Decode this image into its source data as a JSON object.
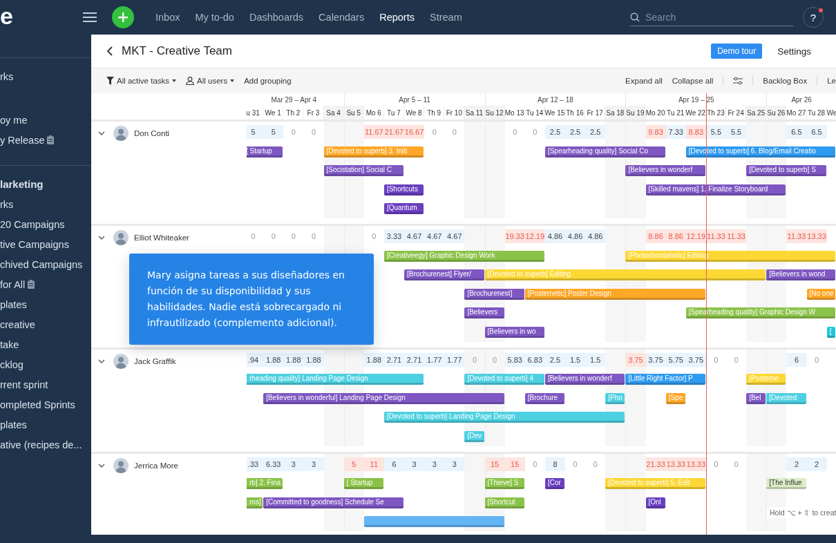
{
  "topbar": {
    "logo": "e",
    "nav": [
      {
        "label": "Inbox",
        "selected": false
      },
      {
        "label": "My to-do",
        "selected": false
      },
      {
        "label": "Dashboards",
        "selected": false
      },
      {
        "label": "Calendars",
        "selected": false
      },
      {
        "label": "Reports",
        "selected": true
      },
      {
        "label": "Stream",
        "selected": false
      }
    ],
    "search": {
      "placeholder": "Search"
    },
    "help": "?",
    "help_badge": true
  },
  "sidebar": {
    "groups": [
      {
        "divider": true,
        "items": [
          {
            "label": "rks",
            "kind": "link"
          }
        ]
      },
      {
        "divider": false,
        "items": [
          {
            "label": "oy me",
            "kind": "link"
          },
          {
            "label": "y Release",
            "kind": "doc"
          }
        ]
      },
      {
        "divider": true,
        "items": [
          {
            "label": "larketing",
            "kind": "heading"
          },
          {
            "label": "rks",
            "kind": "link"
          },
          {
            "label": "20 Campaigns",
            "kind": "link"
          },
          {
            "label": "tive Campaigns",
            "kind": "link"
          },
          {
            "label": "chived Campaigns",
            "kind": "link"
          },
          {
            "label": "for All",
            "kind": "doc"
          },
          {
            "label": "plates",
            "kind": "link"
          },
          {
            "label": "creative",
            "kind": "link"
          },
          {
            "label": "take",
            "kind": "link"
          },
          {
            "label": "cklog",
            "kind": "link"
          },
          {
            "label": "rrent sprint",
            "kind": "link"
          },
          {
            "label": "ompleted Sprints",
            "kind": "link"
          },
          {
            "label": "plates",
            "kind": "link"
          },
          {
            "label": "ative (recipes de...",
            "kind": "link"
          }
        ]
      }
    ]
  },
  "header": {
    "title": "MKT - Creative Team",
    "demo_button": "Demo tour",
    "settings": "Settings"
  },
  "toolbar": {
    "task_filter": "All active tasks",
    "user_filter": "All users",
    "grouping": "Add grouping",
    "expand": "Expand all",
    "collapse": "Collapse all",
    "backlog": "Backlog Box",
    "more": "Le"
  },
  "timeline": {
    "weeks": [
      {
        "label": "Mar 29 – Apr 4",
        "days": [
          {
            "label": "u 31",
            "weekend": false,
            "today": false
          },
          {
            "label": "We 1",
            "weekend": false,
            "today": false
          },
          {
            "label": "Th 2",
            "weekend": false,
            "today": false
          },
          {
            "label": "Fr 3",
            "weekend": false,
            "today": false
          },
          {
            "label": "Sa 4",
            "weekend": true,
            "today": false
          }
        ]
      },
      {
        "label": "Apr 5 – 11",
        "days": [
          {
            "label": "Su 5",
            "weekend": true,
            "today": false
          },
          {
            "label": "Mo 6",
            "weekend": false,
            "today": false
          },
          {
            "label": "Tu 7",
            "weekend": false,
            "today": false
          },
          {
            "label": "We 8",
            "weekend": false,
            "today": false
          },
          {
            "label": "Th 9",
            "weekend": false,
            "today": false
          },
          {
            "label": "Fr 10",
            "weekend": false,
            "today": false
          },
          {
            "label": "Sa 11",
            "weekend": true,
            "today": false
          }
        ]
      },
      {
        "label": "Apr 12 – 18",
        "days": [
          {
            "label": "Su 12",
            "weekend": true,
            "today": false
          },
          {
            "label": "Mo 13",
            "weekend": false,
            "today": false
          },
          {
            "label": "Tu 14",
            "weekend": false,
            "today": false
          },
          {
            "label": "We 15",
            "weekend": false,
            "today": false
          },
          {
            "label": "Th 16",
            "weekend": false,
            "today": false
          },
          {
            "label": "Fr 17",
            "weekend": false,
            "today": false
          },
          {
            "label": "Sa 18",
            "weekend": true,
            "today": false
          }
        ]
      },
      {
        "label": "Apr 19 – 25",
        "days": [
          {
            "label": "Su 19",
            "weekend": true,
            "today": false
          },
          {
            "label": "Mo 20",
            "weekend": false,
            "today": false
          },
          {
            "label": "Tu 21",
            "weekend": false,
            "today": false
          },
          {
            "label": "We 22",
            "weekend": false,
            "today": false
          },
          {
            "label": "Th 23",
            "weekend": false,
            "today": true
          },
          {
            "label": "Fr 24",
            "weekend": false,
            "today": false
          },
          {
            "label": "Sa 25",
            "weekend": true,
            "today": false
          }
        ]
      },
      {
        "label": "Apr 26",
        "days": [
          {
            "label": "Su 26",
            "weekend": true,
            "today": false
          },
          {
            "label": "Mo 27",
            "weekend": false,
            "today": false
          },
          {
            "label": "Tu 28",
            "weekend": false,
            "today": false
          },
          {
            "label": "We",
            "weekend": false,
            "today": false
          }
        ]
      }
    ]
  },
  "people": [
    {
      "name": "Don Conti",
      "expanded": true,
      "cells": [
        {
          "value": "5",
          "kind": "normal"
        },
        {
          "value": "5",
          "kind": "normal"
        },
        {
          "value": "0",
          "kind": "zero"
        },
        {
          "value": "0",
          "kind": "zero"
        },
        {
          "kind": "empty"
        },
        {
          "kind": "empty"
        },
        {
          "value": "11.67",
          "kind": "over"
        },
        {
          "value": "21.67",
          "kind": "over"
        },
        {
          "value": "16.67",
          "kind": "over"
        },
        {
          "value": "0",
          "kind": "zero"
        },
        {
          "value": "0",
          "kind": "zero"
        },
        {
          "kind": "empty"
        },
        {
          "kind": "empty"
        },
        {
          "value": "0",
          "kind": "zero"
        },
        {
          "value": "0",
          "kind": "zero"
        },
        {
          "value": "2.5",
          "kind": "normal"
        },
        {
          "value": "2.5",
          "kind": "normal"
        },
        {
          "value": "2.5",
          "kind": "normal"
        },
        {
          "kind": "empty"
        },
        {
          "kind": "empty"
        },
        {
          "value": "9.83",
          "kind": "over"
        },
        {
          "value": "7.33",
          "kind": "normal"
        },
        {
          "value": "8.83",
          "kind": "over"
        },
        {
          "value": "5.5",
          "kind": "normal"
        },
        {
          "value": "5.5",
          "kind": "normal"
        },
        {
          "kind": "empty"
        },
        {
          "kind": "empty"
        },
        {
          "value": "6.5",
          "kind": "normal"
        },
        {
          "value": "6.5",
          "kind": "normal"
        },
        {
          "kind": "empty"
        }
      ],
      "lanes": [
        [
          {
            "label": "[ Startup",
            "color": "#7e57c2"
          },
          {
            "label": "[Devoted to superb] 3. Initi",
            "color": "#ffa726"
          },
          {
            "label": "[Spearheading quality] Social Co",
            "color": "#7e57c2"
          },
          {
            "label": "[Devoted to superb] 6. Blog/Email Creatio",
            "color": "#2f9bf0"
          }
        ],
        [
          {
            "label": "[Socistation] Social C",
            "color": "#7e57c2"
          },
          {
            "label": "[Believers in wonderf",
            "color": "#7e57c2"
          },
          {
            "label": "[Devoted to superb] S",
            "color": "#7e57c2"
          }
        ],
        [
          {
            "label": "[Shortcuts",
            "color": "#6a3fc0"
          },
          {
            "label": "[Skilled mavens] 1. Finalize Storyboard",
            "color": "#7e57c2"
          }
        ],
        [
          {
            "label": "[Quantum",
            "color": "#6a3fc0"
          }
        ]
      ]
    },
    {
      "name": "Elliot Whiteaker",
      "expanded": true,
      "cells": [
        {
          "value": "0",
          "kind": "zero"
        },
        {
          "value": "0",
          "kind": "zero"
        },
        {
          "value": "0",
          "kind": "zero"
        },
        {
          "value": "0",
          "kind": "zero"
        },
        {
          "kind": "empty"
        },
        {
          "kind": "empty"
        },
        {
          "value": "0",
          "kind": "zero"
        },
        {
          "value": "3.33",
          "kind": "normal"
        },
        {
          "value": "4.67",
          "kind": "normal"
        },
        {
          "value": "4.67",
          "kind": "normal"
        },
        {
          "value": "4.67",
          "kind": "normal"
        },
        {
          "kind": "empty"
        },
        {
          "kind": "empty"
        },
        {
          "value": "19.33",
          "kind": "over"
        },
        {
          "value": "12.19",
          "kind": "over"
        },
        {
          "value": "4.86",
          "kind": "normal"
        },
        {
          "value": "4.86",
          "kind": "normal"
        },
        {
          "value": "4.86",
          "kind": "normal"
        },
        {
          "kind": "empty"
        },
        {
          "kind": "empty"
        },
        {
          "value": "8.86",
          "kind": "over"
        },
        {
          "value": "8.86",
          "kind": "over"
        },
        {
          "value": "12.19",
          "kind": "over"
        },
        {
          "value": "11.33",
          "kind": "over"
        },
        {
          "value": "11.33",
          "kind": "over"
        },
        {
          "kind": "empty"
        },
        {
          "kind": "empty"
        },
        {
          "value": "11.33",
          "kind": "over"
        },
        {
          "value": "13.33",
          "kind": "over"
        },
        {
          "kind": "empty"
        }
      ],
      "lanes": [
        [
          {
            "label": "[Creativeegy] Graphic Design Work",
            "color": "#8bc34a"
          },
          {
            "label": "[Photoshootaholic] Editing",
            "color": "#fdd835"
          }
        ],
        [
          {
            "label": "[Brochurenest] Flyer/",
            "color": "#7e57c2"
          },
          {
            "label": "[Devoted to superb] Editing",
            "color": "#fdd835"
          },
          {
            "label": "[Believers in wond",
            "color": "#7e57c2"
          }
        ],
        [
          {
            "label": "[Brochurenest]",
            "color": "#7e57c2"
          },
          {
            "label": "[Posternetic] Poster Design",
            "color": "#ffa726"
          },
          {
            "label": "[No one",
            "color": "#ffa726"
          }
        ],
        [
          {
            "label": "[Believers",
            "color": "#7e57c2"
          },
          {
            "label": "[Spearheading quality] Graphic Design W",
            "color": "#8bc34a"
          }
        ],
        [
          {
            "label": "[Believers in wo",
            "color": "#7e57c2"
          },
          {
            "label": "[",
            "color": "#26c6da"
          }
        ]
      ]
    },
    {
      "name": "Jack Graffik",
      "expanded": true,
      "cells": [
        {
          "value": ".94",
          "kind": "normal"
        },
        {
          "value": "1.88",
          "kind": "normal"
        },
        {
          "value": "1.88",
          "kind": "normal"
        },
        {
          "value": "1.88",
          "kind": "normal"
        },
        {
          "kind": "empty"
        },
        {
          "kind": "empty"
        },
        {
          "value": "1.88",
          "kind": "normal"
        },
        {
          "value": "2.71",
          "kind": "normal"
        },
        {
          "value": "2.71",
          "kind": "normal"
        },
        {
          "value": "1.77",
          "kind": "normal"
        },
        {
          "value": "1.77",
          "kind": "normal"
        },
        {
          "value": "0",
          "kind": "zero"
        },
        {
          "value": "0",
          "kind": "zero"
        },
        {
          "value": "5.83",
          "kind": "normal"
        },
        {
          "value": "6.83",
          "kind": "normal"
        },
        {
          "value": "2.5",
          "kind": "normal"
        },
        {
          "value": "1.5",
          "kind": "normal"
        },
        {
          "value": "1.5",
          "kind": "normal"
        },
        {
          "kind": "empty"
        },
        {
          "value": "3.75",
          "kind": "over"
        },
        {
          "value": "3.75",
          "kind": "normal"
        },
        {
          "value": "5.75",
          "kind": "normal"
        },
        {
          "value": "3.75",
          "kind": "normal"
        },
        {
          "value": "0",
          "kind": "zero"
        },
        {
          "value": "0",
          "kind": "zero"
        },
        {
          "kind": "empty"
        },
        {
          "kind": "empty"
        },
        {
          "value": "6",
          "kind": "normal"
        },
        {
          "value": "0",
          "kind": "zero"
        },
        {
          "kind": "empty"
        }
      ],
      "lanes": [
        [
          {
            "label": "rheading quality] Landing Page Design",
            "color": "#4dd0e1"
          },
          {
            "label": "[Devoted to superb] 4",
            "color": "#4dd0e1"
          },
          {
            "label": "[Believers in wonderf",
            "color": "#7e57c2"
          },
          {
            "label": "[Little Right Factor] P",
            "color": "#2f9bf0"
          },
          {
            "label": "[Posterne",
            "color": "#fdd835"
          }
        ],
        [
          {
            "label": "[Believers in wonderful] Landing Page Design",
            "color": "#7e57c2"
          },
          {
            "label": "[Brochure",
            "color": "#7e57c2"
          },
          {
            "label": "[Pho",
            "color": "#4dd0e1"
          },
          {
            "label": "[Spe",
            "color": "#ffa726"
          },
          {
            "label": "[Bel",
            "color": "#7e57c2"
          },
          {
            "label": "[Devoted",
            "color": "#4dd0e1"
          }
        ],
        [
          {
            "label": "[Devoted to superb] Landing Page Design",
            "color": "#4dd0e1"
          }
        ],
        [
          {
            "label": "[Dev",
            "color": "#4dd0e1"
          }
        ]
      ]
    },
    {
      "name": "Jerrica More",
      "expanded": true,
      "cells": [
        {
          "value": ".33",
          "kind": "normal"
        },
        {
          "value": "6.33",
          "kind": "normal"
        },
        {
          "value": "3",
          "kind": "normal"
        },
        {
          "value": "3",
          "kind": "normal"
        },
        {
          "kind": "empty"
        },
        {
          "value": "5",
          "kind": "over"
        },
        {
          "value": "11",
          "kind": "over"
        },
        {
          "value": "6",
          "kind": "normal"
        },
        {
          "value": "3",
          "kind": "normal"
        },
        {
          "value": "3",
          "kind": "normal"
        },
        {
          "value": "3",
          "kind": "normal"
        },
        {
          "kind": "empty"
        },
        {
          "value": "15",
          "kind": "over"
        },
        {
          "value": "15",
          "kind": "over"
        },
        {
          "value": "0",
          "kind": "zero"
        },
        {
          "value": "8",
          "kind": "normal"
        },
        {
          "value": "0",
          "kind": "zero"
        },
        {
          "value": "0",
          "kind": "zero"
        },
        {
          "kind": "empty"
        },
        {
          "kind": "empty"
        },
        {
          "value": "21.33",
          "kind": "over"
        },
        {
          "value": "13.33",
          "kind": "over"
        },
        {
          "value": "13.33",
          "kind": "over"
        },
        {
          "value": "0",
          "kind": "zero"
        },
        {
          "value": "0",
          "kind": "zero"
        },
        {
          "kind": "empty"
        },
        {
          "kind": "empty"
        },
        {
          "value": "2",
          "kind": "normal"
        },
        {
          "value": "2",
          "kind": "normal"
        },
        {
          "kind": "empty"
        }
      ],
      "lanes": [
        [
          {
            "label": "rb] 2. Fina",
            "color": "#8bc34a"
          },
          {
            "label": "[ Startup",
            "color": "#8bc34a"
          },
          {
            "label": "[Thieve] S",
            "color": "#8bc34a"
          },
          {
            "label": "[Cor",
            "color": "#6a3fc0"
          },
          {
            "label": "[Devoted to superb] 5. Edit",
            "color": "#fdd835"
          },
          {
            "label": "[The Influe",
            "color": "#dcedc8"
          }
        ],
        [
          {
            "label": "ros]",
            "color": "#8bc34a"
          },
          {
            "label": "[Committed to goodness] Schedule Se",
            "color": "#7e57c2"
          },
          {
            "label": "[Shortcut",
            "color": "#8bc34a"
          },
          {
            "label": "[Onl",
            "color": "#6a3fc0"
          }
        ],
        [
          {
            "color": "#64b5f6"
          }
        ]
      ]
    }
  ],
  "callout": "Mary asigna tareas a sus diseñadores en función de su disponibilidad y sus habilidades. Nadie está sobrecargado ni infrautilizado (complemento adicional).",
  "hint": "Hold ⌥ + ⇧ to creat"
}
